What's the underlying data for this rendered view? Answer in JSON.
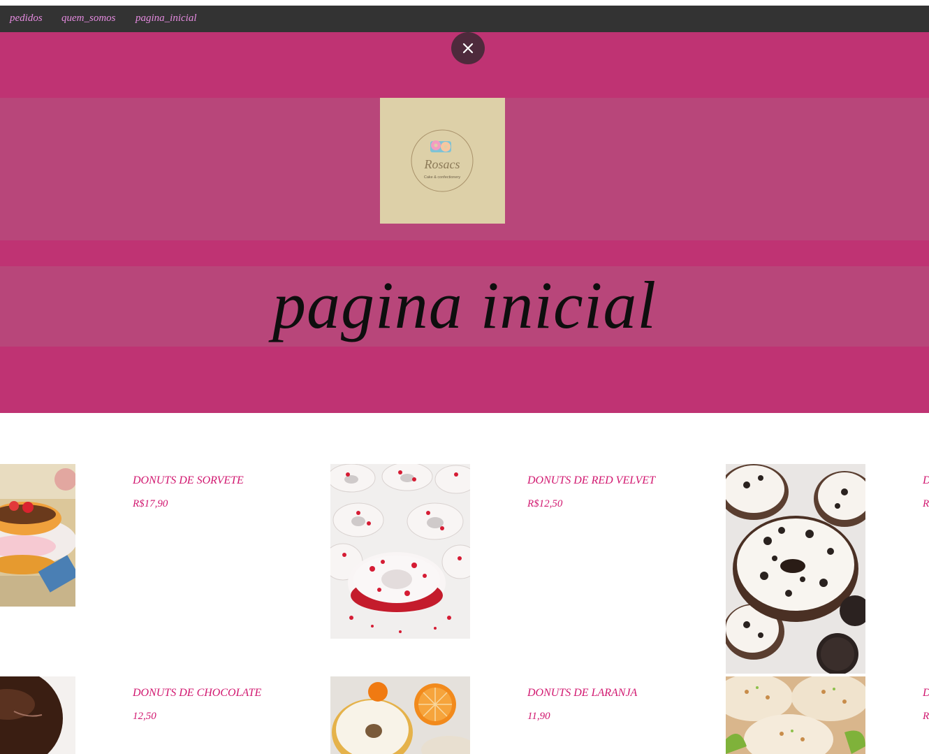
{
  "nav": {
    "links": [
      "pedidos",
      "quem_somos",
      "pagina_inicial"
    ]
  },
  "hero": {
    "title": "pagina inicial",
    "close_symbol": "×",
    "logo": {
      "brand": "Rosacs",
      "tagline": "Cake & confectionery"
    }
  },
  "products": [
    {
      "name": "DONUTS DE SORVETE",
      "price": "R$17,90"
    },
    {
      "name": "DONUTS DE RED VELVET",
      "price": "R$12,50"
    },
    {
      "name": "D",
      "price": "R"
    },
    {
      "name": "DONUTS DE CHOCOLATE",
      "price": "12,50"
    },
    {
      "name": "DONUTS DE LARANJA",
      "price": "11,90"
    },
    {
      "name": "D",
      "price": "R"
    }
  ],
  "colors": {
    "nav_bg": "#333333",
    "nav_link": "#e58be0",
    "hero_bg": "#bf3373",
    "hero_band": "#b8467a",
    "product_text": "#d1176f"
  }
}
